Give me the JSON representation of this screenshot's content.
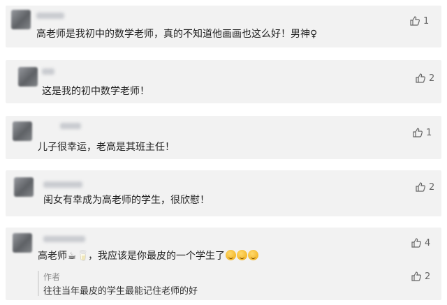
{
  "comments": [
    {
      "text": "高老师是我初中的数学老师，真的不知道他画画也这么好！男神♀",
      "likes": "1"
    },
    {
      "text": "这是我的初中数学老师！",
      "likes": "2"
    },
    {
      "text": "儿子很幸运，老高是其班主任！",
      "likes": "1"
    },
    {
      "text": "闺女有幸成为高老师的学生，很欣慰！",
      "likes": "2"
    },
    {
      "text_prefix": "高老师",
      "text_middle": "，我应该是你最皮的一个学生了",
      "likes": "4",
      "reply": {
        "label": "作者",
        "text": "往往当年最皮的学生最能记住老师的好",
        "likes": "2"
      }
    }
  ],
  "icons": {
    "like": "thumbs-up-icon",
    "avatar": "avatar",
    "emoji": "laughing-emoji-icon"
  }
}
